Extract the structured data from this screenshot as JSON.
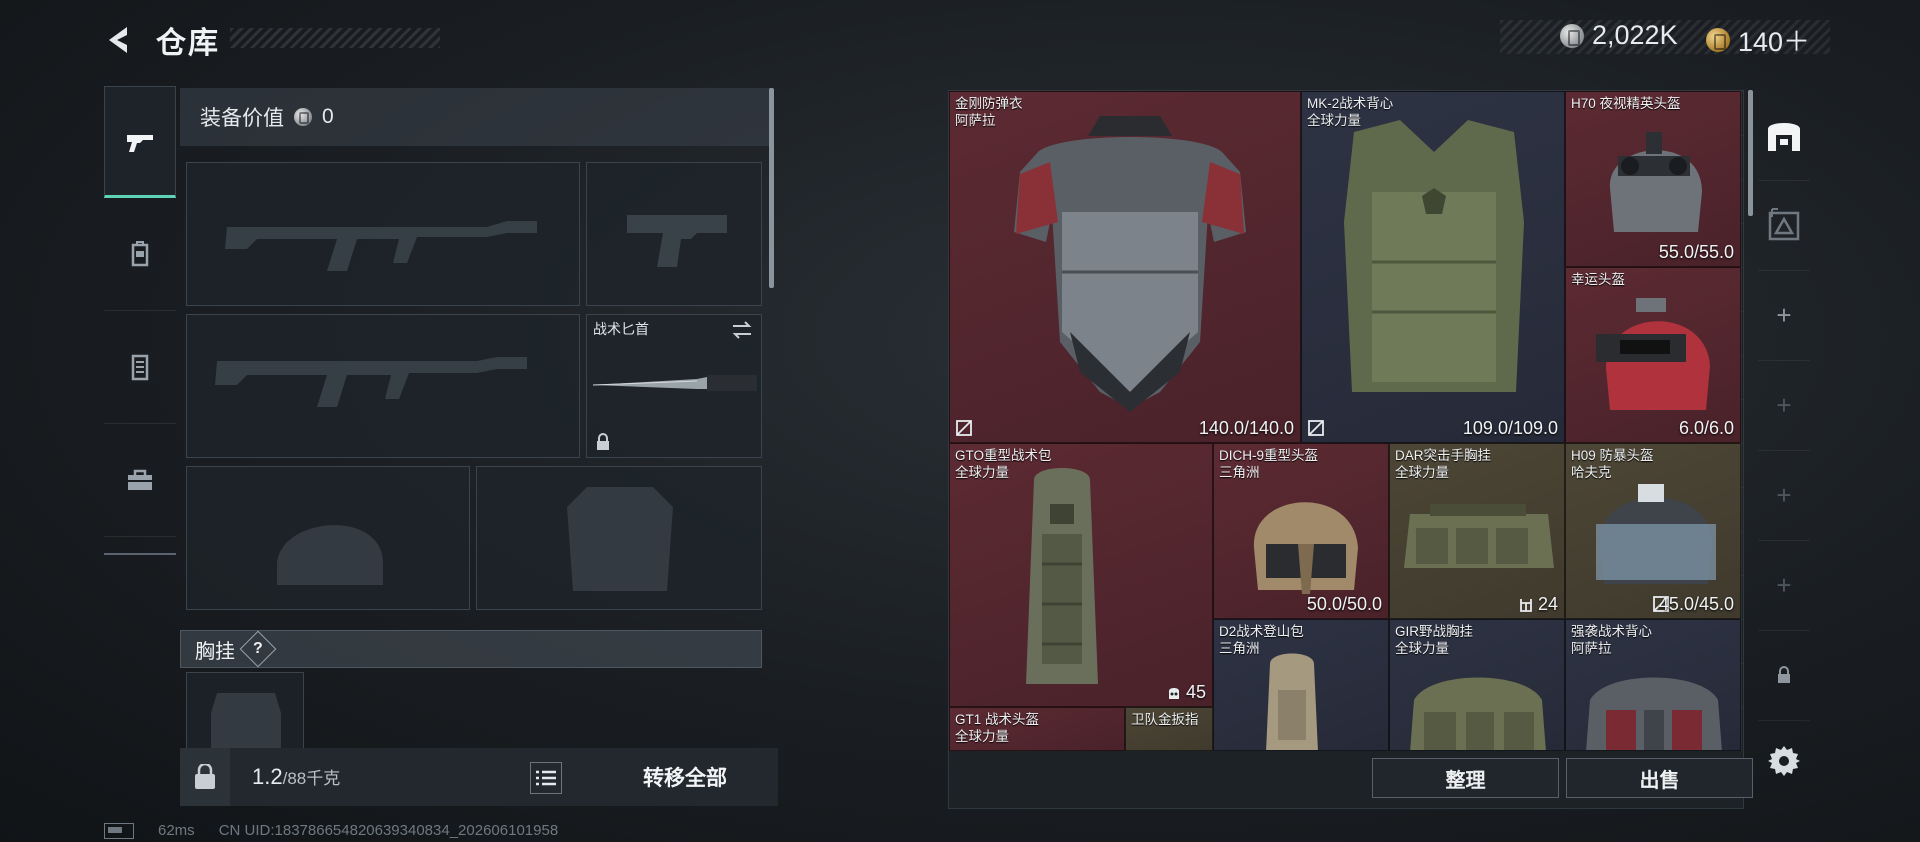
{
  "header": {
    "title": "仓库",
    "currencies": [
      {
        "icon": "silver-coin-icon",
        "value": "2,022K"
      },
      {
        "icon": "gold-coin-icon",
        "value": "140＋"
      }
    ]
  },
  "category_tabs": [
    {
      "name": "pistol-icon",
      "active": true
    },
    {
      "name": "backpack-icon",
      "active": false
    },
    {
      "name": "vest-icon",
      "active": false
    },
    {
      "name": "toolbox-icon",
      "active": false
    }
  ],
  "loadout": {
    "value_label": "装备价值",
    "value": "0",
    "melee_label": "战术匕首",
    "chest_rig_label": "胸挂",
    "help": "?"
  },
  "bottom_bar": {
    "weight": "1.2",
    "capacity": "/88千克",
    "transfer_all": "转移全部"
  },
  "storage": {
    "items": [
      {
        "name": "金刚防弹衣",
        "sub": "阿萨拉",
        "durability": "140.0/140.0",
        "color": "#5c2a32"
      },
      {
        "name": "MK-2战术背心",
        "sub": "全球力量",
        "durability": "109.0/109.0",
        "color": "#2e3344"
      },
      {
        "name": "H70 夜视精英头盔",
        "sub": "",
        "durability": "55.0/55.0",
        "color": "#5c2a32"
      },
      {
        "name": "幸运头盔",
        "sub": "",
        "durability": "6.0/6.0",
        "color": "#5c2a32"
      },
      {
        "name": "GTO重型战术包",
        "sub": "全球力量",
        "count": "45",
        "color": "#5c2a32"
      },
      {
        "name": "DICH-9重型头盔",
        "sub": "三角洲",
        "durability": "50.0/50.0",
        "color": "#5c2a32"
      },
      {
        "name": "DAR突击手胸挂",
        "sub": "全球力量",
        "count": "24",
        "color": "#4d4636"
      },
      {
        "name": "H09 防暴头盔",
        "sub": "哈夫克",
        "durability": "45.0/45.0",
        "color": "#4d4636"
      },
      {
        "name": "GT1 战术头盔",
        "sub": "全球力量",
        "color": "#5c2a32"
      },
      {
        "name": "卫队金扳指",
        "sub": "",
        "color": "#4d4636"
      },
      {
        "name": "D2战术登山包",
        "sub": "三角洲",
        "color": "#2e3344"
      },
      {
        "name": "GIR野战胸挂",
        "sub": "全球力量",
        "color": "#2e3344"
      },
      {
        "name": "强袭战术背心",
        "sub": "阿萨拉",
        "color": "#2e3344"
      }
    ],
    "sort_label": "整理",
    "sell_label": "出售"
  },
  "status_bar": {
    "ping": "62ms",
    "uid": "CN UID:183786654820639340834_202606101958"
  }
}
